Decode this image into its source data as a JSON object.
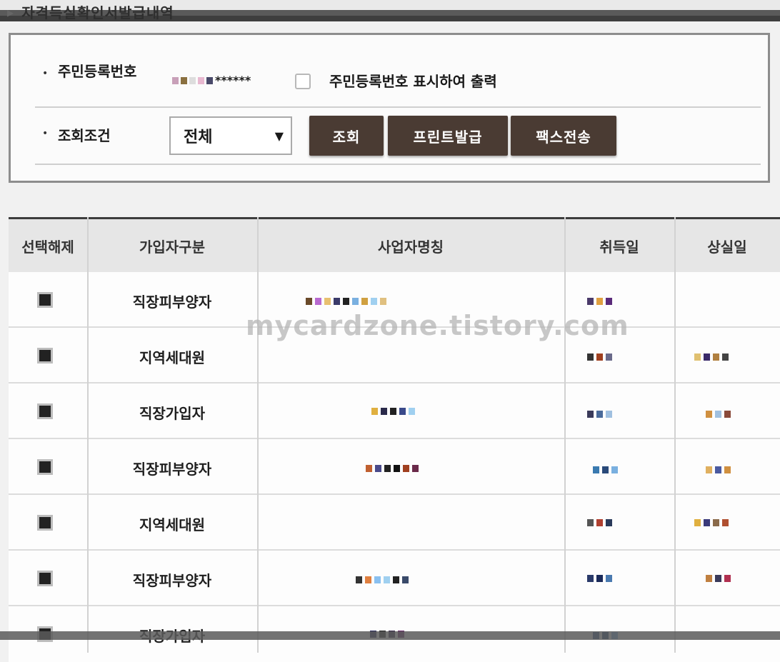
{
  "page": {
    "title": "자격득실확인서발급내역"
  },
  "form": {
    "resident_label": "주민등록번호",
    "resident_masked": "******",
    "show_resident_label": "주민등록번호 표시하여 출력",
    "show_resident_checked": false,
    "condition_label": "조회조건",
    "condition_value": "전체",
    "buttons": {
      "search": "조회",
      "print": "프린트발급",
      "fax": "팩스전송"
    }
  },
  "table": {
    "headers": [
      "선택해제",
      "가입자구분",
      "사업자명칭",
      "취득일",
      "상실일"
    ],
    "rows": [
      {
        "type": "직장피부양자",
        "checked": true
      },
      {
        "type": "지역세대원",
        "checked": true
      },
      {
        "type": "직장가입자",
        "checked": true
      },
      {
        "type": "직장피부양자",
        "checked": true
      },
      {
        "type": "지역세대원",
        "checked": true
      },
      {
        "type": "직장피부양자",
        "checked": true
      },
      {
        "type": "직장가입자",
        "checked": true
      }
    ]
  },
  "watermark": "mycardzone.tistory.com",
  "colors": {
    "button_bg": "#4a3b33",
    "button_text": "#ffffff",
    "header_bg": "#e6e6e6"
  },
  "icons": {
    "title_marker": "triangle-right-icon",
    "dropdown": "caret-down-icon"
  }
}
